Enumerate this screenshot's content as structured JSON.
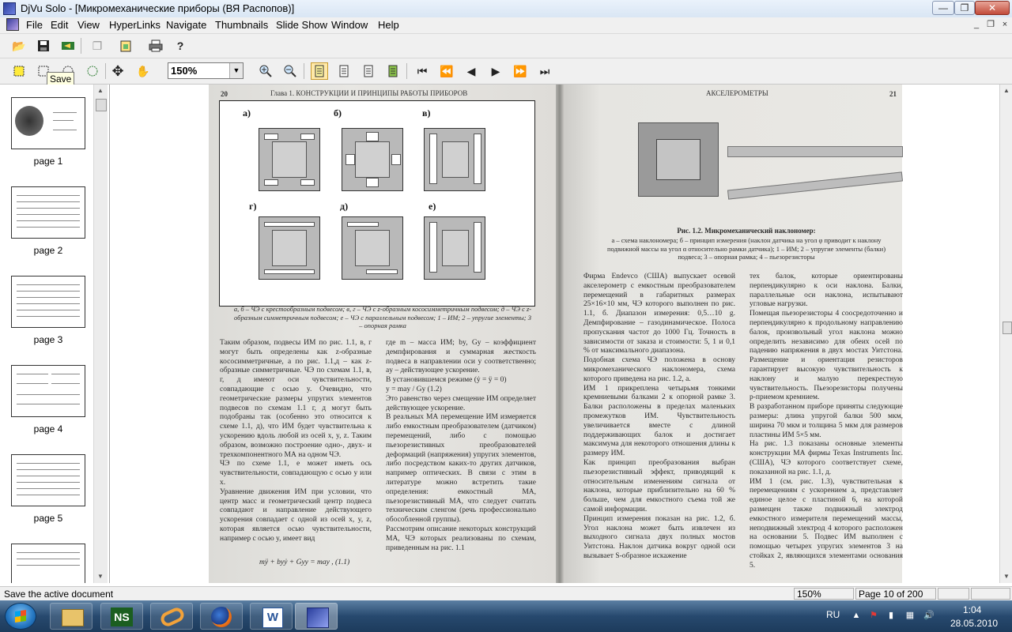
{
  "window": {
    "title": "DjVu Solo - [Микромеханические приборы (ВЯ Распопов)]",
    "controls": {
      "minimize": "—",
      "maximize": "❐",
      "close": "✕"
    }
  },
  "menu": {
    "items": [
      "File",
      "Edit",
      "View",
      "HyperLinks",
      "Navigate",
      "Thumbnails",
      "Slide Show",
      "Window",
      "Help"
    ],
    "mdi": {
      "minimize": "_",
      "restore": "❐",
      "close": "×"
    }
  },
  "toolbar": {
    "zoom_value": "150%",
    "tooltip": "Save"
  },
  "thumbnails": [
    {
      "label": "page 1"
    },
    {
      "label": "page 2"
    },
    {
      "label": "page 3"
    },
    {
      "label": "page 4"
    },
    {
      "label": "page 5"
    }
  ],
  "document": {
    "left_page": {
      "number": "20",
      "header": "Глава 1. КОНСТРУКЦИИ И ПРИНЦИПЫ РАБОТЫ ПРИБОРОВ",
      "figure_labels": [
        "а)",
        "б)",
        "в)",
        "г)",
        "д)",
        "е)"
      ],
      "caption": "а, б – ЧЭ с крестообразным подвесом; в, г – ЧЭ с z-образным кососимметричным подвесом; д – ЧЭ с z-образным симметричным подвесом; е – ЧЭ с параллельным подвесом; 1 – ИМ; 2 – упругие элементы; 3 – опорная рамка",
      "col1": "Таким образом, подвесы ИМ по рис. 1.1, в, г могут быть определены как z-образные кососимметричные, а по рис. 1.1,д – как z-образные симметричные. ЧЭ по схемам 1.1, в, г, д имеют оси чувствительности, совпадающие с осью y. Очевидно, что геометрические размеры упругих элементов подвесов по схемам 1.1 г, д могут быть подобраны так (особенно это относится к схеме 1.1, д), что ИМ будет чувствительна к ускорению вдоль любой из осей x, y, z. Таким образом, возможно построение одно-, двух- и трехкомпонентного МА на одном ЧЭ.\nЧЭ по схеме 1.1, е может иметь ось чувствительности, совпадающую с осью y или x.\nУравнение движения ИМ при условии, что центр масс и геометрический центр подвеса совпадают и направление действующего ускорения совпадает с одной из осей x, y, z, которая является осью чувствительности, например с осью y, имеет вид",
      "col2": "где m – масса ИМ; by, Gy – коэффициент демпфирования и суммарная жесткость подвеса в направлении оси y соответственно; ay – действующее ускорение.\nВ установившемся режиме (ẏ = ÿ = 0)\ny = may / Gy   (1.2)\nЭто равенство через смещение ИМ определяет действующее ускорение.\nВ реальных МА перемещение ИМ измеряется либо емкостным преобразователем (датчиком) перемещений, либо с помощью пьезорезистивных преобразователей деформаций (напряжения) упругих элементов, либо посредством каких-то других датчиков, например оптических. В связи с этим в литературе можно встретить такие определения: емкостный МА, пьезорезистивный МА, что следует считать техническим сленгом (речь профессионально обособленной группы).\nРассмотрим описание некоторых конструкций МА, ЧЭ которых реализованы по схемам, приведенным на рис. 1.1",
      "equation": "mÿ + byẏ + Gyy = may ,   (1.1)"
    },
    "right_page": {
      "number": "21",
      "header": "АКСЕЛЕРОМЕТРЫ",
      "figure_title": "Рис. 1.2. Микромеханический наклономер:",
      "figure_caption": "а – схема наклономера; б – принцип измерения (наклон датчика на угол φ приводит к наклону подвижной массы на угол α относительно рамки датчика); 1 – ИМ; 2 – упругие элементы (балки) подвеса; 3 – опорная рамка; 4 – пьезорезисторы",
      "col1": "Фирма Endevco (США) выпускает осевой акселерометр с емкостным преобразователем перемещений в габаритных размерах 25×16×10 мм, ЧЭ которого выполнен по рис. 1.1, б. Диапазон измерения: 0,5…10 g. Демпфирование – газодинамическое. Полоса пропускания частот до 1000 Гц. Точность в зависимости от заказа и стоимости: 5, 1 и 0,1 % от максимального диапазона.\nПодобная схема ЧЭ положена в основу микромеханического наклономера, схема которого приведена на рис. 1.2, а.\nИМ 1 прикреплена четырьмя тонкими кремниевыми балками 2 к опорной рамке 3. Балки расположены в пределах маленьких промежутков ИМ. Чувствительность увеличивается вместе с длиной поддерживающих балок и достигает максимума для некоторого отношения длины к размеру ИМ.\nКак принцип преобразования выбран пьезорезистивный эффект, приводящий к относительным изменениям сигнала от наклона, которые приблизительно на 60 % больше, чем для емкостного съема той же самой информации.\nПринцип измерения показан на рис. 1.2, б. Угол наклона может быть извлечен из выходного сигнала двух полных мостов Уитстона. Наклон датчика вокруг одной оси вызывает S-образное искажение",
      "col2": "тех балок, которые ориентированы перпендикулярно к оси наклона. Балки, параллельные оси наклона, испытывают угловые нагрузки.\nПомещая пьезорезисторы 4 соосредоточенно и перпендикулярно к продольному направлению балок, произвольный угол наклона можно определить независимо для обеих осей по падению напряжения в двух мостах Уитстона. Размещение и ориентация резисторов гарантирует высокую чувствительность к наклону и малую перекрестную чувствительность. Пьезорезисторы получены p-приемом кремнием.\nВ разработанном приборе приняты следующие размеры: длина упругой балки 500 мкм, ширина 70 мкм и толщина 5 мкм для размеров пластины ИМ 5×5 мм.\nНа рис. 1.3 показаны основные элементы конструкции МА фирмы Texas Instruments Inc. (США), ЧЭ которого соответствует схеме, показанной на рис. 1.1, д.\nИМ 1 (см. рис. 1.3), чувствительная к перемещениям с ускорением a, представляет единое целое с пластиной 6, на которой размещен также подвижный электрод емкостного измерителя перемещений массы, неподвижный электрод 4 которого расположен на основании 5. Подвес ИМ выполнен с помощью четырех упругих элементов 3 на стойках 2, являющихся элементами основания 5."
    }
  },
  "status": {
    "text": "Save the active document",
    "zoom": "150%",
    "page": "Page 10 of 200"
  },
  "taskbar": {
    "lang": "RU",
    "time": "1:04",
    "date": "28.05.2010"
  }
}
